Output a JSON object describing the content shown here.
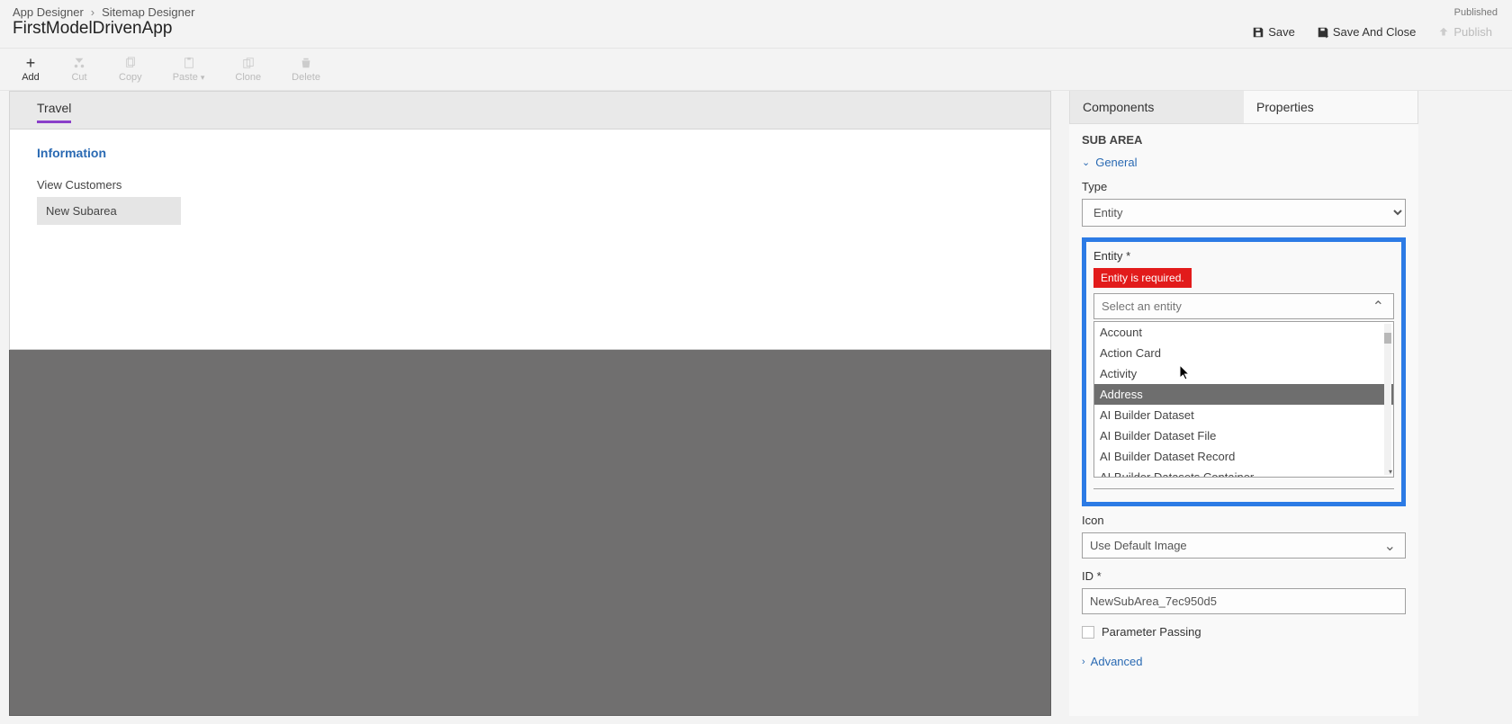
{
  "breadcrumb": {
    "item1": "App Designer",
    "item2": "Sitemap Designer"
  },
  "app_title": "FirstModelDrivenApp",
  "header": {
    "published": "Published",
    "save": "Save",
    "save_and_close": "Save And Close",
    "publish": "Publish"
  },
  "toolbar": {
    "add": "Add",
    "cut": "Cut",
    "copy": "Copy",
    "paste": "Paste",
    "clone": "Clone",
    "delete": "Delete"
  },
  "canvas": {
    "area_name": "Travel",
    "group_name": "Information",
    "sub1": "View Customers",
    "sub2": "New Subarea"
  },
  "panel": {
    "tabs": {
      "components": "Components",
      "properties": "Properties"
    },
    "section": "SUB AREA",
    "general": "General",
    "advanced": "Advanced",
    "type_label": "Type",
    "type_value": "Entity",
    "entity_label": "Entity *",
    "entity_error": "Entity is required.",
    "entity_placeholder": "Select an entity",
    "entity_options": {
      "o0": "Account",
      "o1": "Action Card",
      "o2": "Activity",
      "o3": "Address",
      "o4": "AI Builder Dataset",
      "o5": "AI Builder Dataset File",
      "o6": "AI Builder Dataset Record",
      "o7": "AI Builder Datasets Container"
    },
    "icon_label": "Icon",
    "icon_value": "Use Default Image",
    "id_label": "ID *",
    "id_value": "NewSubArea_7ec950d5",
    "parameter_passing": "Parameter Passing"
  }
}
